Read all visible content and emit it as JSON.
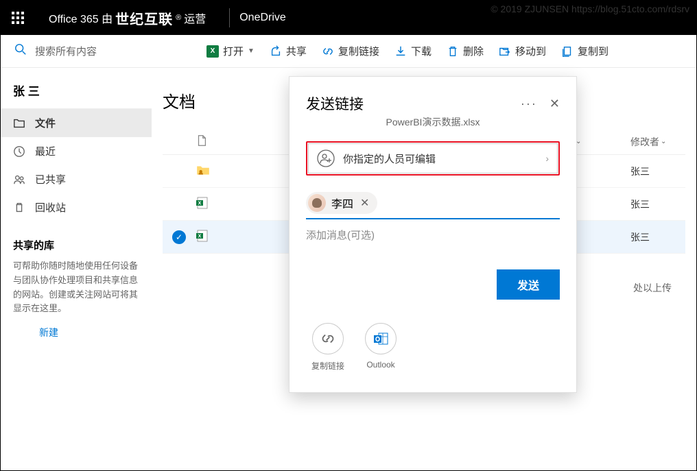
{
  "watermark": "© 2019 ZJUNSEN https://blog.51cto.com/rdsrv",
  "topbar": {
    "brand_prefix": "Office 365 由",
    "brand_main": "世纪互联",
    "brand_suffix": "运营",
    "app": "OneDrive",
    "reg": "®"
  },
  "search": {
    "placeholder": "搜索所有内容"
  },
  "commands": {
    "open": "打开",
    "share": "共享",
    "copylink": "复制链接",
    "download": "下载",
    "delete": "删除",
    "moveto": "移动到",
    "copyto": "复制到"
  },
  "sidebar": {
    "user": "张 三",
    "items": [
      {
        "label": "文件"
      },
      {
        "label": "最近"
      },
      {
        "label": "已共享"
      },
      {
        "label": "回收站"
      }
    ],
    "shared_lib": "共享的库",
    "shared_desc": "可帮助你随时随地使用任何设备与团队协作处理项目和共享信息的网站。创建或关注网站可将其显示在这里。",
    "new": "新建"
  },
  "main": {
    "title": "文档",
    "col_modifier": "修改者",
    "rows": [
      {
        "modifier": "张三",
        "type": "folder-shared"
      },
      {
        "modifier": "张三",
        "type": "xlsx"
      },
      {
        "modifier": "张三",
        "type": "xlsx",
        "selected": true
      }
    ],
    "upload_hint": "处以上传"
  },
  "dialog": {
    "title": "发送链接",
    "subtitle": "PowerBI演示数据.xlsx",
    "perm": "你指定的人员可编辑",
    "recipient": "李四",
    "msg_placeholder": "添加消息(可选)",
    "send": "发送",
    "copy_link": "复制链接",
    "outlook": "Outlook"
  }
}
